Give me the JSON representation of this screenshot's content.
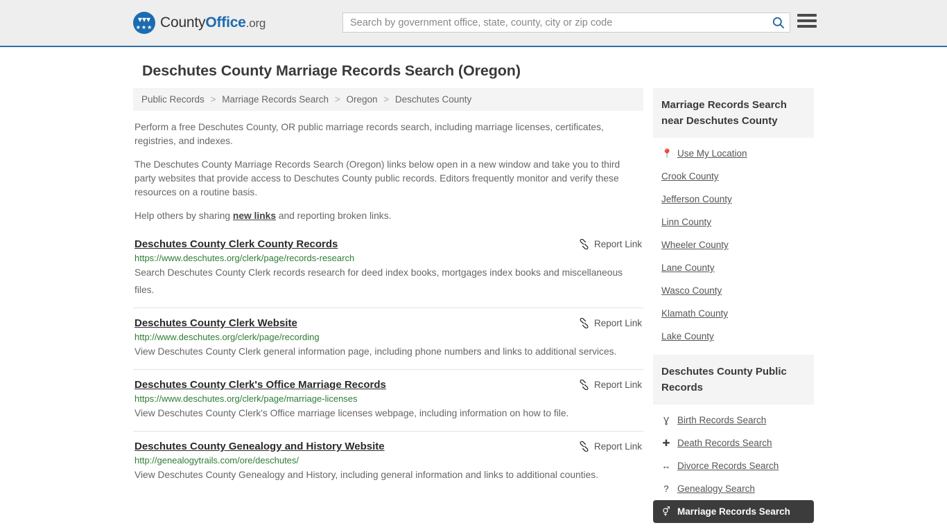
{
  "header": {
    "brand": {
      "part1": "County",
      "part2": "Office",
      "part3": ".org",
      "badge_icon": "eagle-seal-icon"
    },
    "search": {
      "placeholder": "Search by government office, state, county, city or zip code",
      "value": "",
      "search_icon": "search-icon"
    },
    "menu_icon": "hamburger-menu-icon"
  },
  "page": {
    "title": "Deschutes County Marriage Records Search (Oregon)",
    "breadcrumb": [
      {
        "label": "Public Records"
      },
      {
        "label": "Marriage Records Search"
      },
      {
        "label": "Oregon"
      },
      {
        "label": "Deschutes County"
      }
    ],
    "breadcrumb_separator": ">",
    "intro": {
      "p1": "Perform a free Deschutes County, OR public marriage records search, including marriage licenses, certificates, registries, and indexes.",
      "p2": "The Deschutes County Marriage Records Search (Oregon) links below open in a new window and take you to third party websites that provide access to Deschutes County public records. Editors frequently monitor and verify these resources on a routine basis.",
      "p3_before": "Help others by sharing ",
      "p3_link": "new links",
      "p3_after": " and reporting broken links."
    }
  },
  "results": {
    "report_label": "Report Link",
    "report_icon": "broken-link-icon",
    "items": [
      {
        "title": "Deschutes County Clerk County Records",
        "url": "https://www.deschutes.org/clerk/page/records-research",
        "desc": "Search Deschutes County Clerk records research for deed index books, mortgages index books and miscellaneous files."
      },
      {
        "title": "Deschutes County Clerk Website",
        "url": "http://www.deschutes.org/clerk/page/recording",
        "desc": "View Deschutes County Clerk general information page, including phone numbers and links to additional services."
      },
      {
        "title": "Deschutes County Clerk's Office Marriage Records",
        "url": "https://www.deschutes.org/clerk/page/marriage-licenses",
        "desc": "View Deschutes County Clerk's Office marriage licenses webpage, including information on how to file."
      },
      {
        "title": "Deschutes County Genealogy and History Website",
        "url": "http://genealogytrails.com/ore/deschutes/",
        "desc": "View Deschutes County Genealogy and History, including general information and links to additional counties."
      }
    ]
  },
  "sidebar": {
    "nearby": {
      "heading": "Marriage Records Search near Deschutes County",
      "items": [
        {
          "label": "Use My Location",
          "icon": "map-pin-icon",
          "glyph": "⮟"
        },
        {
          "label": "Crook County",
          "icon": "",
          "glyph": ""
        },
        {
          "label": "Jefferson County",
          "icon": "",
          "glyph": ""
        },
        {
          "label": "Linn County",
          "icon": "",
          "glyph": ""
        },
        {
          "label": "Wheeler County",
          "icon": "",
          "glyph": ""
        },
        {
          "label": "Lane County",
          "icon": "",
          "glyph": ""
        },
        {
          "label": "Wasco County",
          "icon": "",
          "glyph": ""
        },
        {
          "label": "Klamath County",
          "icon": "",
          "glyph": ""
        },
        {
          "label": "Lake County",
          "icon": "",
          "glyph": ""
        }
      ]
    },
    "public_records": {
      "heading": "Deschutes County Public Records",
      "items": [
        {
          "label": "Birth Records Search",
          "icon": "baby-icon",
          "glyph": "Ɣ",
          "active": false
        },
        {
          "label": "Death Records Search",
          "icon": "cross-icon",
          "glyph": "✚",
          "active": false
        },
        {
          "label": "Divorce Records Search",
          "icon": "left-right-arrow-icon",
          "glyph": "↔",
          "active": false
        },
        {
          "label": "Genealogy Search",
          "icon": "question-mark-icon",
          "glyph": "?",
          "active": false
        },
        {
          "label": "Marriage Records Search",
          "icon": "male-female-icon",
          "glyph": "⚥",
          "active": true
        }
      ]
    }
  },
  "colors": {
    "brand_blue": "#1c6bb0",
    "header_bg": "#eeeeee",
    "panel_bg": "#f4f4f4",
    "url_green": "#2e7d32",
    "active_bg": "#3c3c3c"
  }
}
